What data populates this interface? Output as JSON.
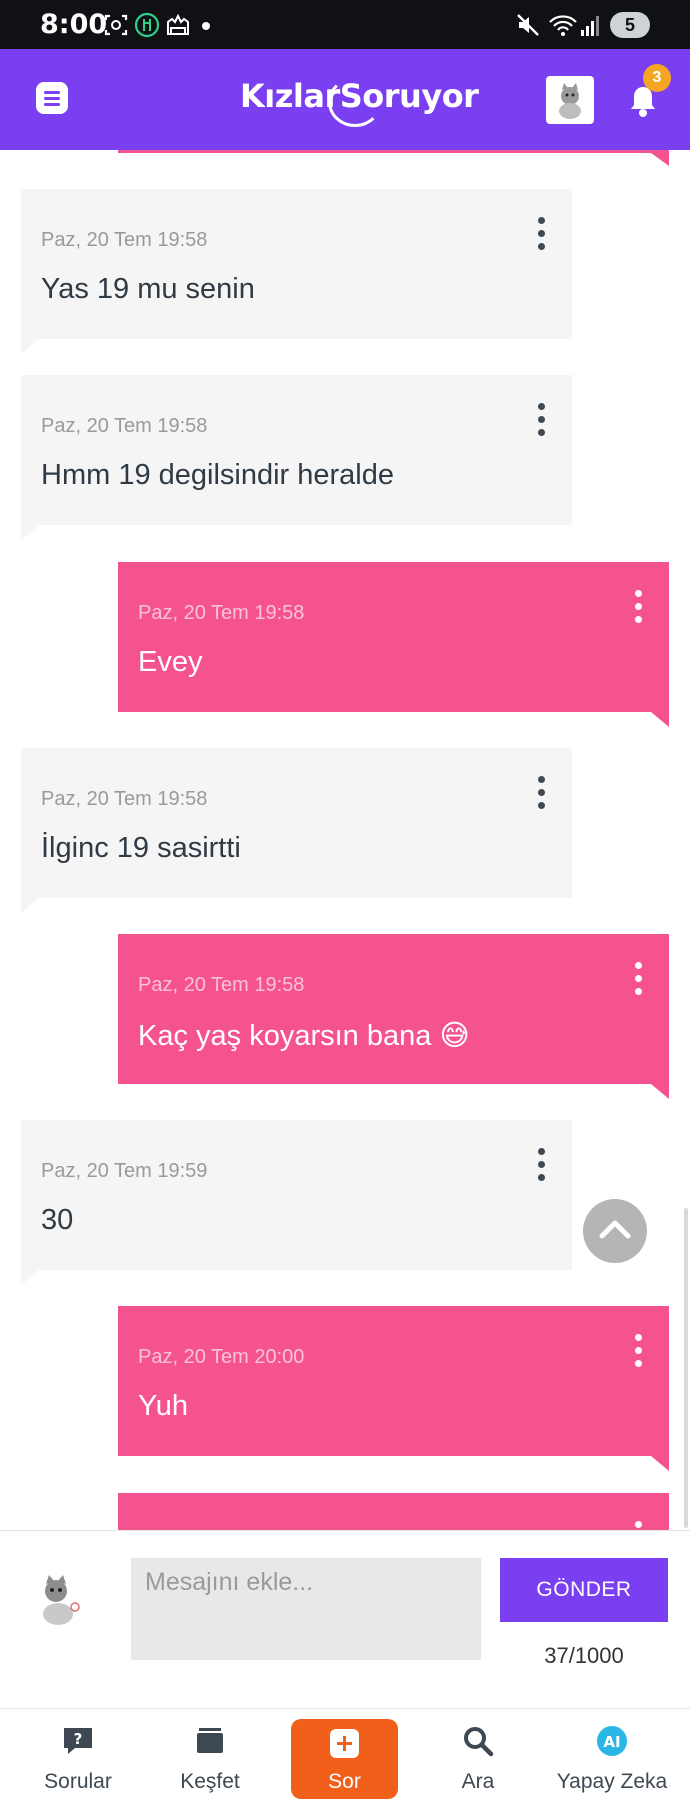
{
  "status_bar": {
    "time": "8:00",
    "battery": "5",
    "icons": [
      "screenshot-icon",
      "food-icon",
      "camera-icon",
      "dot-icon",
      "mute-icon",
      "wifi-icon",
      "signal-icon",
      "battery-icon"
    ]
  },
  "header": {
    "logo": "KızlarSoruyor",
    "notification_count": "3",
    "brand_color": "#7b3ff2"
  },
  "messages": [
    {
      "side": "in",
      "timestamp": "Paz, 20 Tem 19:58",
      "text": "Yas 19 mu senin"
    },
    {
      "side": "in",
      "timestamp": "Paz, 20 Tem 19:58",
      "text": "Hmm 19 degilsindir heralde"
    },
    {
      "side": "out",
      "timestamp": "Paz, 20 Tem 19:58",
      "text": "Evey"
    },
    {
      "side": "in",
      "timestamp": "Paz, 20 Tem 19:58",
      "text": "İlginc 19 sasirtti"
    },
    {
      "side": "out",
      "timestamp": "Paz, 20 Tem 19:58",
      "text": "Kaç yaş koyarsın bana 😅"
    },
    {
      "side": "in",
      "timestamp": "Paz, 20 Tem 19:59",
      "text": "30"
    },
    {
      "side": "out",
      "timestamp": "Paz, 20 Tem 20:00",
      "text": "Yuh"
    }
  ],
  "composer": {
    "placeholder": "Mesajını ekle...",
    "value": "",
    "send_label": "GÖNDER",
    "counter": "37/1000"
  },
  "bottom_nav": {
    "items": [
      {
        "label": "Sorular",
        "icon": "question-icon"
      },
      {
        "label": "Keşfet",
        "icon": "cards-icon"
      },
      {
        "label": "Sor",
        "icon": "plus-icon"
      },
      {
        "label": "Ara",
        "icon": "search-icon"
      },
      {
        "label": "Yapay Zeka",
        "icon": "ai-icon"
      }
    ]
  },
  "colors": {
    "incoming_bubble": "#f5f5f5",
    "outgoing_bubble": "#f5538f",
    "accent_orange": "#f0601a"
  }
}
